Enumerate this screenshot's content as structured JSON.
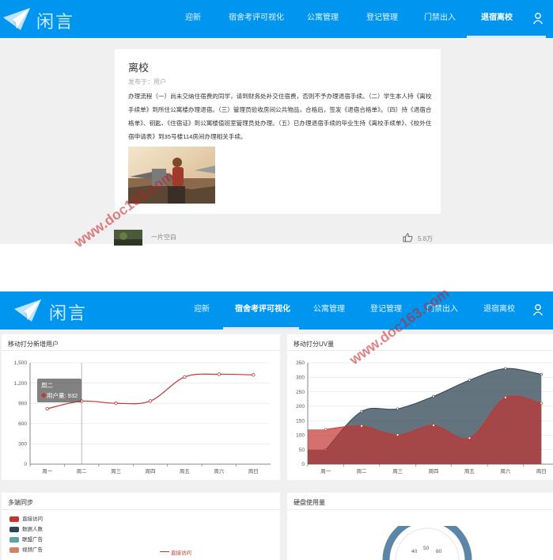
{
  "app": {
    "brand": "闲言"
  },
  "nav": [
    {
      "label": "迎新"
    },
    {
      "label": "宿舍考评可视化"
    },
    {
      "label": "公寓管理"
    },
    {
      "label": "登记管理"
    },
    {
      "label": "门禁出入"
    },
    {
      "label": "退宿离校"
    }
  ],
  "article": {
    "title": "离校",
    "meta": "发布于：用户",
    "body": "办理流程（一）尚未交纳住宿费的同学，请到财务处补交住宿费，否则不予办理退宿手续。（二）学生本人持《离校手续单》到所住公寓楼办理退宿。（三）管理员验收房间公共物品，合格后，签发《退宿合格单》。（四）持《退宿合格单》、钥匙、《住宿证》到公寓楼值班室管理员处办理。（五）已办理退宿手续的毕业生持《离校手续单》、《校外住宿申请表》到35号楼114房间办理相关手续。"
  },
  "feed_item": {
    "label": "一片空白",
    "likes": "5.8万"
  },
  "watermark": "www.doc163.com",
  "panels": {
    "p1": {
      "title": "移动打分新增用户"
    },
    "p2": {
      "title": "移动打分UV量"
    },
    "p3": {
      "title": "多端同步"
    },
    "p4": {
      "title": "硬盘使用量"
    }
  },
  "legend": [
    {
      "label": "直接访问",
      "color": "#c23531"
    },
    {
      "label": "数据人数",
      "color": "#2f4554"
    },
    {
      "label": "联盟广告",
      "color": "#61a0a8"
    },
    {
      "label": "视频广告",
      "color": "#d48265"
    }
  ],
  "legend_inline": "直接访问",
  "tooltip": {
    "day": "周二",
    "label": "用户量: 932"
  },
  "gauge_ticks": [
    "40",
    "50",
    "60"
  ],
  "chart_data": [
    {
      "type": "line",
      "title": "移动打分新增用户",
      "categories": [
        "周一",
        "周二",
        "周三",
        "周四",
        "周五",
        "周六",
        "周日"
      ],
      "series": [
        {
          "name": "用户量",
          "values": [
            820,
            932,
            901,
            934,
            1290,
            1330,
            1320
          ]
        }
      ],
      "ylim": [
        0,
        1500
      ],
      "yticks": [
        "0",
        "300",
        "600",
        "900",
        "1,200",
        "1,500"
      ],
      "smooth": true,
      "color": "#c23531"
    },
    {
      "type": "area",
      "title": "移动打分UV量",
      "categories": [
        "周一",
        "周二",
        "周三",
        "周四",
        "周五",
        "周六",
        "周日"
      ],
      "series": [
        {
          "values": [
            120,
            132,
            101,
            134,
            90,
            230,
            210
          ],
          "color": "#c23531"
        },
        {
          "values": [
            50,
            182,
            191,
            234,
            290,
            330,
            310
          ],
          "color": "#2f4554"
        }
      ],
      "ylim": [
        0,
        350
      ],
      "yticks": [
        "0",
        "50",
        "100",
        "150",
        "200",
        "250",
        "300",
        "350"
      ]
    }
  ]
}
